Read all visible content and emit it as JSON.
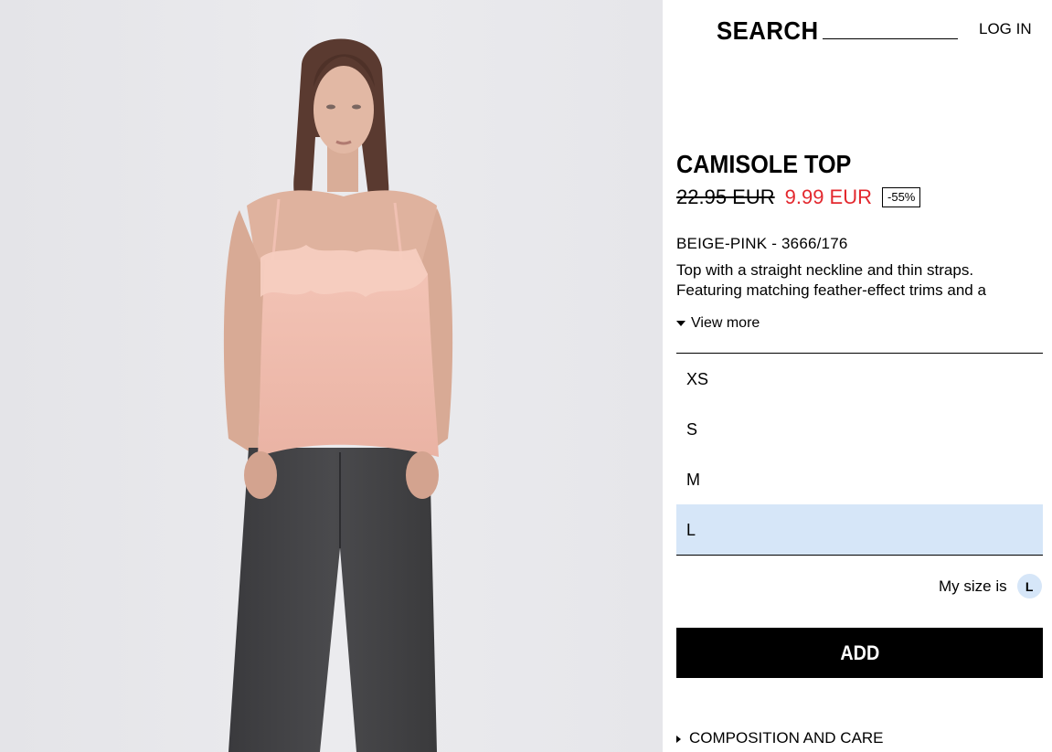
{
  "header": {
    "search_label": "SEARCH",
    "search_value": "",
    "login_label": "LOG IN"
  },
  "product": {
    "name": "CAMISOLE TOP",
    "old_price": "22.95 EUR",
    "new_price": "9.99 EUR",
    "discount": "-55%",
    "color_ref": "BEIGE-PINK - 3666/176",
    "description_line1": "Top with a straight neckline and thin straps.",
    "description_line2": "Featuring matching feather-effect trims and a",
    "view_more": "View more"
  },
  "sizes": [
    {
      "label": "XS",
      "selected": false
    },
    {
      "label": "S",
      "selected": false
    },
    {
      "label": "M",
      "selected": false
    },
    {
      "label": "L",
      "selected": true
    }
  ],
  "my_size": {
    "label": "My size is",
    "value": "L"
  },
  "add_button": "ADD",
  "composition_label": "COMPOSITION AND CARE",
  "colors": {
    "sale_red": "#e3282e",
    "selected_size_bg": "#d6e6f8",
    "photo_bg": "#e9e9ec"
  },
  "icons": {
    "view_more": "triangle-down-icon",
    "composition": "triangle-right-icon"
  }
}
